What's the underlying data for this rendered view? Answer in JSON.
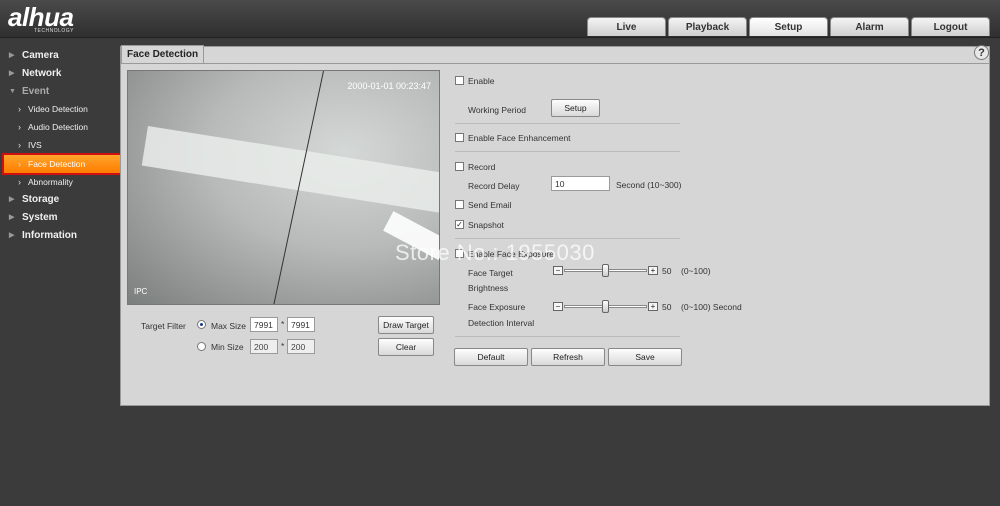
{
  "header": {
    "logo": "alhua",
    "logo_sub": "TECHNOLOGY",
    "tabs": [
      "Live",
      "Playback",
      "Setup",
      "Alarm",
      "Logout"
    ],
    "active_tab": "Setup"
  },
  "sidebar": {
    "items": [
      {
        "label": "Camera"
      },
      {
        "label": "Network"
      },
      {
        "label": "Event"
      },
      {
        "label": "Video Detection"
      },
      {
        "label": "Audio Detection"
      },
      {
        "label": "IVS"
      },
      {
        "label": "Face Detection"
      },
      {
        "label": "Abnormality"
      },
      {
        "label": "Storage"
      },
      {
        "label": "System"
      },
      {
        "label": "Information"
      }
    ]
  },
  "panel": {
    "title": "Face Detection",
    "help": "?",
    "video": {
      "timestamp": "2000-01-01 00:23:47",
      "channel": "IPC"
    },
    "target_filter": {
      "label": "Target Filter",
      "max_label": "Max Size",
      "max_w": "7991",
      "max_h": "7991",
      "min_label": "Min Size",
      "min_w": "200",
      "min_h": "200",
      "times": "*",
      "draw_target": "Draw Target",
      "clear": "Clear"
    },
    "settings": {
      "enable": "Enable",
      "working_period": "Working Period",
      "setup_btn": "Setup",
      "enable_face_enh": "Enable Face Enhancement",
      "record": "Record",
      "record_delay": "Record Delay",
      "record_delay_value": "10",
      "record_delay_unit": "Second (10~300)",
      "send_email": "Send Email",
      "snapshot": "Snapshot",
      "snapshot_checked": "✓",
      "enable_face_exposure": "Enable Face Exposure",
      "face_target": "Face Target",
      "brightness": "Brightness",
      "face_target_value": "50",
      "face_target_range": "(0~100)",
      "face_exposure": "Face Exposure",
      "detection_interval": "Detection Interval",
      "face_exposure_value": "50",
      "face_exposure_range": "(0~100) Second",
      "minus": "−",
      "plus": "+"
    },
    "buttons": {
      "default": "Default",
      "refresh": "Refresh",
      "save": "Save"
    }
  },
  "watermark": "Store No.: 1955030"
}
